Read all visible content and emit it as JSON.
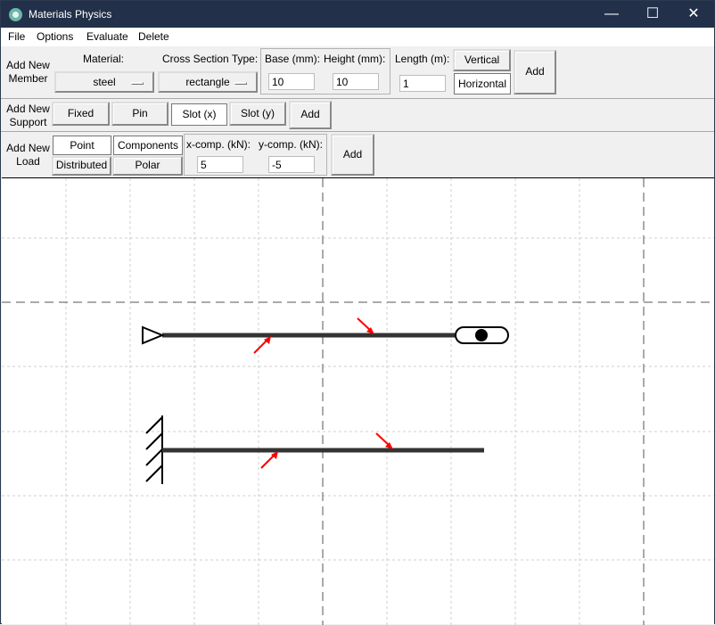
{
  "window": {
    "title": "Materials Physics",
    "controls": {
      "minimize": "—",
      "maximize": "☐",
      "close": "✕"
    }
  },
  "menu": [
    "File",
    "Options",
    "Evaluate",
    "Delete"
  ],
  "member": {
    "section_label": "Add New Member",
    "material_label": "Material:",
    "material_value": "steel",
    "cross_section_label": "Cross Section Type:",
    "cross_section_value": "rectangle",
    "base_label": "Base (mm):",
    "base_value": "10",
    "height_label": "Height (mm):",
    "height_value": "10",
    "length_label": "Length (m):",
    "length_value": "1",
    "orientation_options": [
      "Vertical",
      "Horizontal"
    ],
    "selected_orientation": "Horizontal",
    "add_label": "Add"
  },
  "support": {
    "section_label": "Add New Support",
    "options": [
      "Fixed",
      "Pin",
      "Slot (x)",
      "Slot (y)"
    ],
    "selected": "Slot (x)",
    "add_label": "Add"
  },
  "load": {
    "section_label": "Add New Load",
    "type_options": [
      "Point",
      "Distributed"
    ],
    "selected_type": "Point",
    "component_options": [
      "Components",
      "Polar"
    ],
    "selected_component": "Components",
    "x_comp_label": "x-comp. (kN):",
    "x_comp_value": "5",
    "y_comp_label": "y-comp. (kN):",
    "y_comp_value": "-5",
    "add_label": "Add"
  },
  "colors": {
    "titlebar": "#223149",
    "load_arrow": "#ff0000",
    "member": "#333333",
    "grid": "#cfcfcf"
  },
  "icons": {
    "app": "materials-physics-gear-icon",
    "minimize": "minimize-icon",
    "maximize": "maximize-icon",
    "close": "close-icon"
  },
  "canvas": {
    "members": [
      "horizontal-member-1",
      "horizontal-member-2"
    ],
    "supports": [
      "pin-support",
      "slot-x-support",
      "fixed-support"
    ],
    "loads": [
      "member-1-load-1",
      "member-1-load-2",
      "member-2-load-1",
      "member-2-load-2"
    ]
  }
}
